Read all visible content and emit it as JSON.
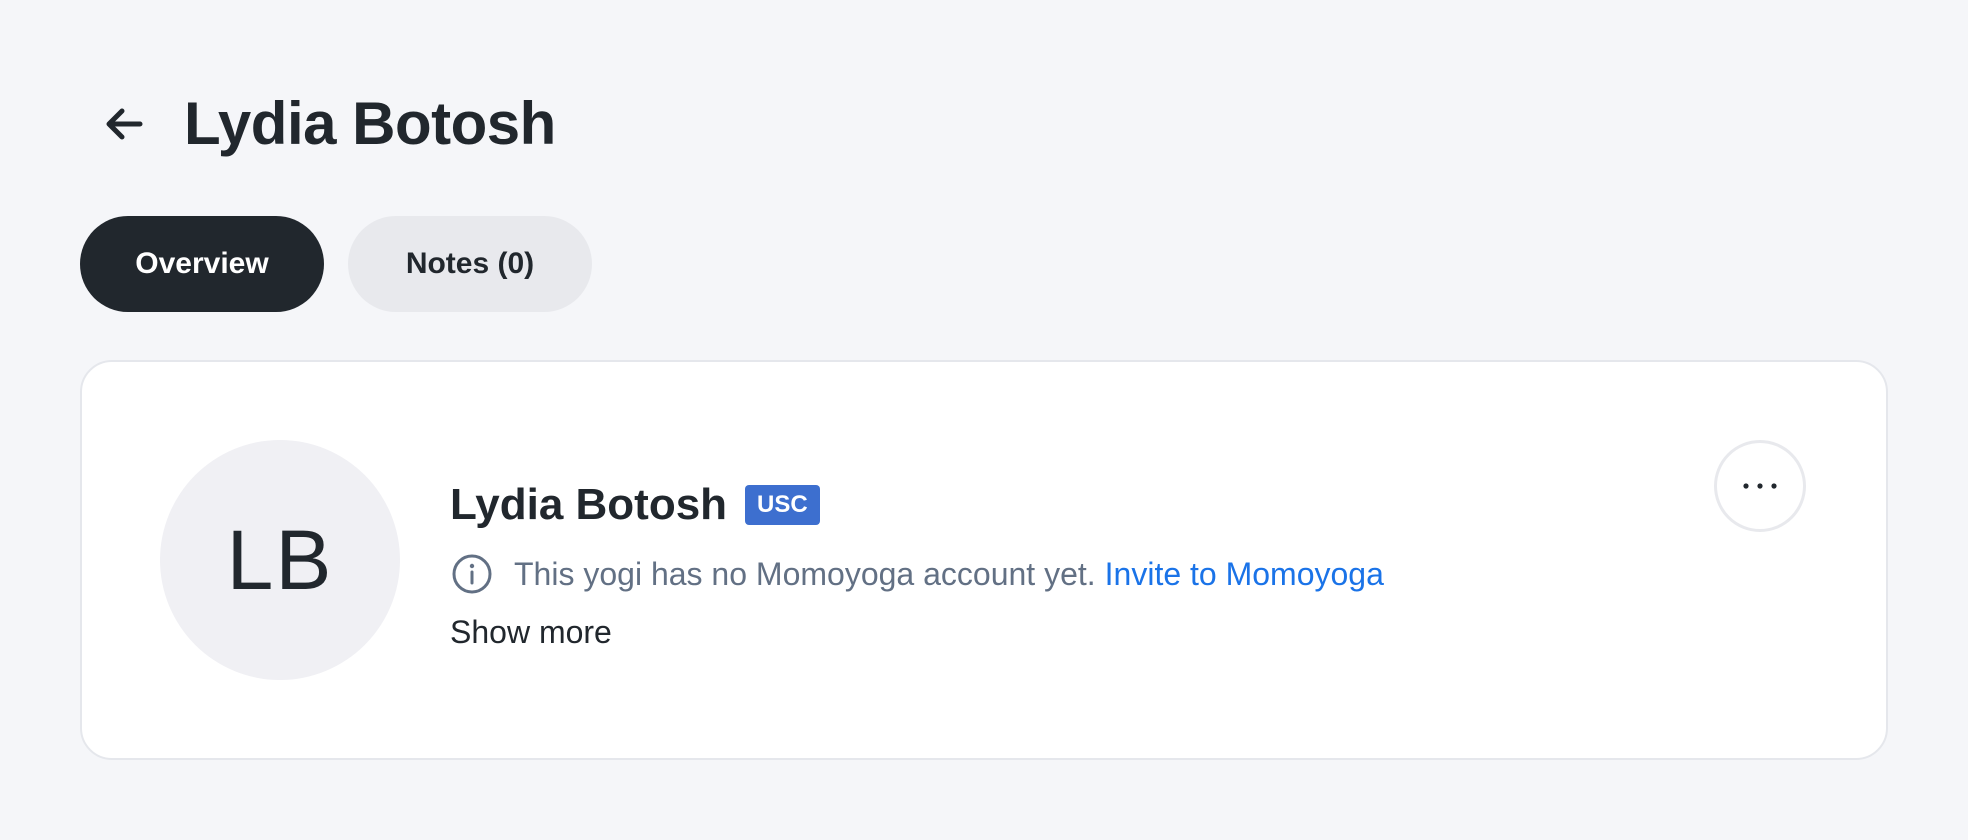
{
  "header": {
    "back_icon": "arrow-left-icon",
    "title": "Lydia Botosh"
  },
  "tabs": [
    {
      "label": "Overview",
      "active": true
    },
    {
      "label": "Notes (0)",
      "active": false
    }
  ],
  "profile": {
    "initials": "LB",
    "name": "Lydia Botosh",
    "badge": "USC",
    "badge_color": "#3d6fcf",
    "notice_icon": "info-icon",
    "notice_text": "This yogi has no Momoyoga account yet.",
    "invite_link": "Invite to Momoyoga",
    "show_more": "Show more",
    "menu_icon": "more-horizontal-icon"
  },
  "colors": {
    "primary": "#21272d",
    "link": "#1a73e8",
    "background": "#f5f6f9"
  }
}
